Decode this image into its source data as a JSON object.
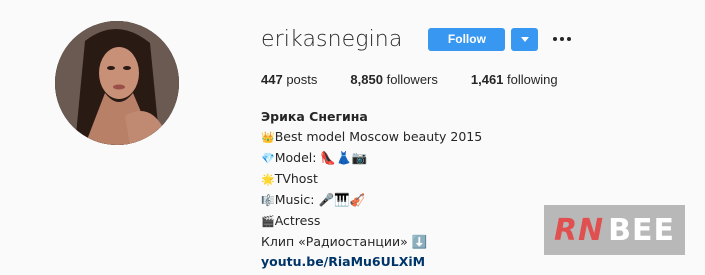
{
  "profile": {
    "username": "erikasnegina",
    "follow_label": "Follow"
  },
  "stats": {
    "posts_count": "447",
    "posts_label": "posts",
    "followers_count": "8,850",
    "followers_label": "followers",
    "following_count": "1,461",
    "following_label": "following"
  },
  "bio": {
    "name": "Эрика Снегина",
    "lines": [
      {
        "emoji": "👑",
        "text": "Best model Moscow beauty 2015"
      },
      {
        "emoji": "💎",
        "text": "Model: 👠👗📷"
      },
      {
        "emoji": "🌟",
        "text": "TVhost"
      },
      {
        "emoji": "🎼",
        "text": "Music: 🎤🎹🎻"
      },
      {
        "emoji": "🎬",
        "text": "Actress"
      },
      {
        "emoji": "",
        "text": "Клип «Радиостанции» ⬇️"
      }
    ],
    "link": "youtu.be/RiaMu6ULXiM"
  },
  "watermark": {
    "part1": "RN",
    "part2": "BEE"
  },
  "colors": {
    "accent": "#3897f0",
    "background": "#fafafa",
    "text": "#262626",
    "link": "#003569"
  },
  "icons": {
    "dropdown": "chevron-down-icon",
    "more": "more-options-icon"
  }
}
